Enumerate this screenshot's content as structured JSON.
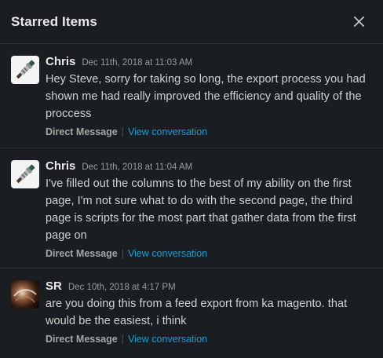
{
  "header": {
    "title": "Starred Items",
    "close_icon": "close-icon"
  },
  "items": [
    {
      "author": "Chris",
      "timestamp": "Dec 11th, 2018 at 11:03 AM",
      "message": "Hey Steve, sorry for taking so long, the export process you had shown me had really improved the efficiency and quality of the proccess",
      "channel": "Direct Message",
      "separator": "|",
      "link": "View conversation"
    },
    {
      "author": "Chris",
      "timestamp": "Dec 11th, 2018 at 11:04 AM",
      "message": "I've filled out the columns to the best of my ability on the first page, I'm not sure what to do with the second page, the third page is scripts for the most part that gather data from the first page on",
      "channel": "Direct Message",
      "separator": "|",
      "link": "View conversation"
    },
    {
      "author": "SR",
      "timestamp": "Dec 10th, 2018 at 4:17 PM",
      "message": "are you doing this from a feed export from ka magento. that would be the easiest, i think",
      "channel": "Direct Message",
      "separator": "|",
      "link": "View conversation"
    }
  ],
  "colors": {
    "background": "#1a1d21",
    "link": "#1d9bd1",
    "divider": "#2e3136"
  }
}
